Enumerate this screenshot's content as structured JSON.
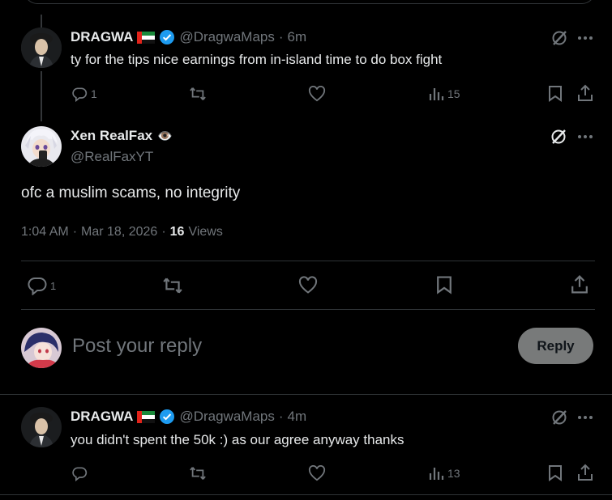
{
  "top_card_partial": {},
  "reply_1": {
    "name": "DRAGWA",
    "handle": "@DragwaMaps",
    "separator": "·",
    "time": "6m",
    "text": "ty for the tips nice earnings from in-island time to do box fight",
    "replies": "1",
    "views": "15"
  },
  "main_tweet": {
    "name": "Xen RealFax",
    "emoji": "👁️",
    "handle": "@RealFaxYT",
    "text": "ofc a muslim scams, no integrity",
    "time": "1:04 AM",
    "separator": "·",
    "date": "Mar 18, 2026",
    "separator2": "·",
    "views_count": "16",
    "views_label": "Views",
    "replies": "1"
  },
  "composer": {
    "placeholder": "Post your reply",
    "reply_label": "Reply"
  },
  "reply_2": {
    "name": "DRAGWA",
    "handle": "@DragwaMaps",
    "separator": "·",
    "time": "4m",
    "text": "you didn't spent the 50k :) as our agree anyway thanks",
    "views": "13"
  },
  "colors": {
    "background": "#000000",
    "text": "#e7e9ea",
    "muted": "#71767b",
    "verified": "#1d9bf0",
    "divider": "#2f3336",
    "reply_button": "#787a7a"
  }
}
